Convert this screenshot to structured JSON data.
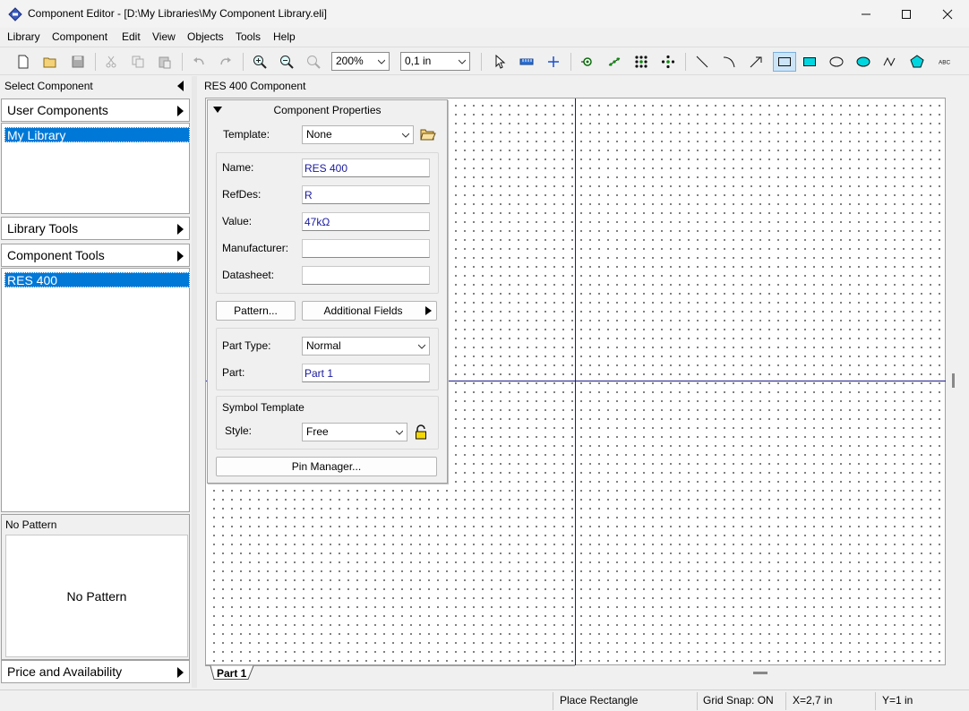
{
  "window": {
    "title": "Component Editor - [D:\\My Libraries\\My Component Library.eli]",
    "minimize_label": "—",
    "maximize_label": "☐",
    "close_label": "✕"
  },
  "menu": [
    "Library",
    "Component",
    "Edit",
    "View",
    "Objects",
    "Tools",
    "Help"
  ],
  "toolbar": {
    "zoom": "200%",
    "grid": "0,1 in"
  },
  "left_panel": {
    "select_component_label": "Select Component",
    "user_components_label": "User Components",
    "library_selected": "My Library",
    "library_tools_label": "Library Tools",
    "component_tools_label": "Component Tools",
    "component_selected": "RES 400",
    "pattern_header": "No Pattern",
    "pattern_preview_text": "No Pattern",
    "price_label": "Price and Availability"
  },
  "canvas": {
    "header": "RES 400 Component",
    "tab": "Part 1"
  },
  "properties": {
    "title": "Component Properties",
    "template_label": "Template:",
    "template_value": "None",
    "name_label": "Name:",
    "name_value": "RES 400",
    "refdes_label": "RefDes:",
    "refdes_value": "R",
    "value_label": "Value:",
    "value_value": "47kΩ",
    "manufacturer_label": "Manufacturer:",
    "manufacturer_value": "",
    "datasheet_label": "Datasheet:",
    "datasheet_value": "",
    "pattern_button": "Pattern...",
    "additional_fields_button": "Additional Fields",
    "part_type_label": "Part Type:",
    "part_type_value": "Normal",
    "part_label": "Part:",
    "part_value": "Part 1",
    "symbol_template_label": "Symbol Template",
    "style_label": "Style:",
    "style_value": "Free",
    "pin_manager_button": "Pin Manager..."
  },
  "status": {
    "mode": "Place Rectangle",
    "grid_snap": "Grid Snap: ON",
    "x": "X=2,7 in",
    "y": "Y=1 in"
  },
  "colors": {
    "selection": "#0078d7",
    "axis": "#1a1a8c",
    "input_text": "#1a1a9e"
  }
}
